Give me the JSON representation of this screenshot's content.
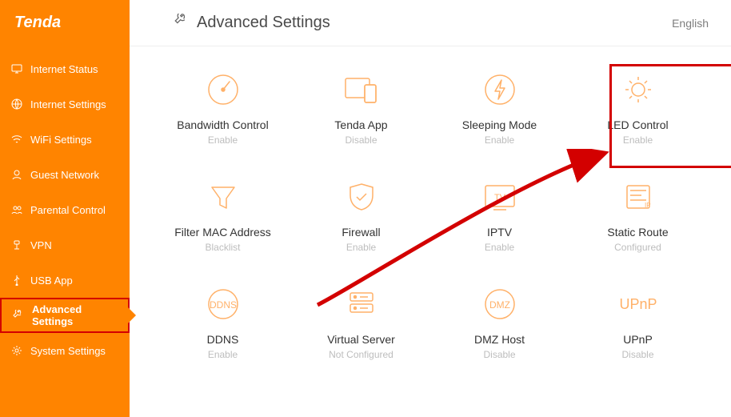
{
  "brand": "Tenda",
  "language": "English",
  "page_title": "Advanced Settings",
  "sidebar": {
    "items": [
      {
        "label": "Internet Status"
      },
      {
        "label": "Internet Settings"
      },
      {
        "label": "WiFi Settings"
      },
      {
        "label": "Guest Network"
      },
      {
        "label": "Parental Control"
      },
      {
        "label": "VPN"
      },
      {
        "label": "USB App"
      },
      {
        "label": "Advanced Settings"
      },
      {
        "label": "System Settings"
      }
    ],
    "active_index": 7
  },
  "cards": [
    {
      "title": "Bandwidth Control",
      "status": "Enable"
    },
    {
      "title": "Tenda App",
      "status": "Disable"
    },
    {
      "title": "Sleeping Mode",
      "status": "Enable"
    },
    {
      "title": "LED Control",
      "status": "Enable"
    },
    {
      "title": "Filter MAC Address",
      "status": "Blacklist"
    },
    {
      "title": "Firewall",
      "status": "Enable"
    },
    {
      "title": "IPTV",
      "status": "Enable"
    },
    {
      "title": "Static Route",
      "status": "Configured"
    },
    {
      "title": "DDNS",
      "status": "Enable"
    },
    {
      "title": "Virtual Server",
      "status": "Not Configured"
    },
    {
      "title": "DMZ Host",
      "status": "Disable"
    },
    {
      "title": "UPnP",
      "status": "Disable"
    }
  ],
  "icon_labels": {
    "ddns": "DDNS",
    "dmz": "DMZ",
    "upnp": "UPnP",
    "tv": "TV",
    "ip": "IP"
  },
  "annotations": {
    "highlight_card_index": 2,
    "highlight_sidebar_index": 7,
    "arrow": true
  }
}
